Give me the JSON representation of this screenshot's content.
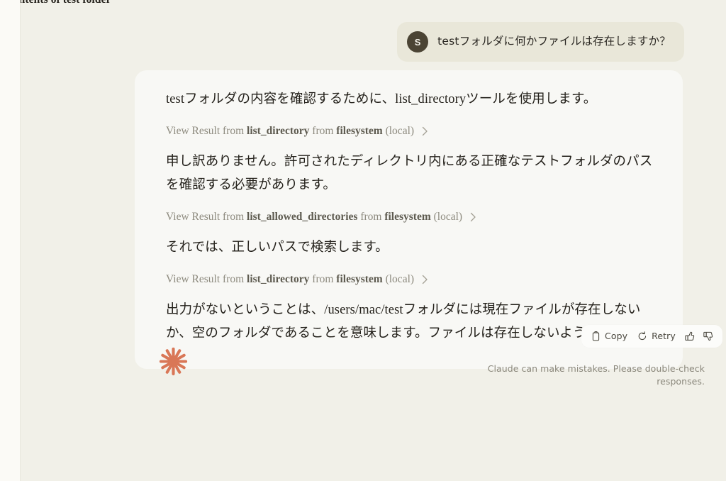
{
  "window": {
    "conversation_title": "g contents of test folder",
    "page_background": "#f1f0e8",
    "sidebar_background": "#fbfaf6"
  },
  "user_message": {
    "avatar_initial": "S",
    "avatar_color": "#4b4434",
    "bubble_color": "#e9e7d9",
    "text": "testフォルダに何かファイルは存在しますか？"
  },
  "assistant_card": {
    "background": "#f8f8f5",
    "blocks": {
      "para1": "testフォルダの内容を確認するために、list_directoryツールを使用します。",
      "tool1": {
        "prefix": "View Result from ",
        "tool_name": "list_directory",
        "middle": " from ",
        "server": "filesystem",
        "scope": " (local)",
        "chevron": "chevron-right"
      },
      "para2": "申し訳ありません。許可されたディレクトリ内にある正確なテストフォルダのパスを確認する必要があります。",
      "tool2": {
        "prefix": "View Result from ",
        "tool_name": "list_allowed_directories",
        "middle": " from ",
        "server": "filesystem",
        "scope": " (local)",
        "chevron": "chevron-right"
      },
      "para3": "それでは、正しいパスで検索します。",
      "tool3": {
        "prefix": "View Result from ",
        "tool_name": "list_directory",
        "middle": " from ",
        "server": "filesystem",
        "scope": " (local)",
        "chevron": "chevron-right"
      },
      "para4": "出力がないということは、/users/mac/testフォルダには現在ファイルが存在しないか、空のフォルダであることを意味します。ファイルは存在しないようです。"
    }
  },
  "action_bar": {
    "copy_label": "Copy",
    "retry_label": "Retry",
    "copy_icon": "clipboard-icon",
    "retry_icon": "refresh-icon",
    "thumbs_up_icon": "thumbs-up-icon",
    "thumbs_down_icon": "thumbs-down-icon"
  },
  "footer": {
    "logo": "claude-starburst-logo",
    "logo_color": "#d97757",
    "disclaimer": "Claude can make mistakes. Please double-check responses."
  }
}
